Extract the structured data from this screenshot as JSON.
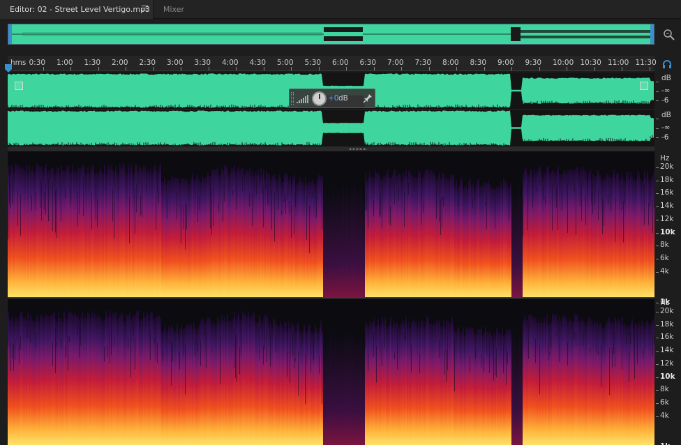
{
  "tabs": {
    "editor_label": "Editor: 02 - Street Level Vertigo.mp3",
    "mixer_label": "Mixer"
  },
  "ruler": {
    "unit": "hms",
    "labels": [
      "0:30",
      "1:00",
      "1:30",
      "2:00",
      "2:30",
      "3:00",
      "3:30",
      "4:00",
      "4:30",
      "5:00",
      "5:30",
      "6:00",
      "6:30",
      "7:00",
      "7:30",
      "8:00",
      "8:30",
      "9:00",
      "9:30",
      "10:00",
      "10:30",
      "11:00",
      "11:30"
    ]
  },
  "hud": {
    "gain_value": "+0",
    "gain_unit": "dB"
  },
  "db_scale": {
    "unit": "dB",
    "inf_label": "-∞",
    "minus6_label": "-6"
  },
  "hz_scale": {
    "unit": "Hz",
    "labels": [
      "20k",
      "18k",
      "16k",
      "14k",
      "12k",
      "10k",
      "8k",
      "6k",
      "4k",
      "1k"
    ]
  },
  "colors": {
    "waveform": "#3ed69e",
    "background": "#1d1d1d",
    "playhead": "#3a8fd0",
    "gain_value": "#5ab0ff"
  },
  "icons": {
    "zoom": "zoom-to-selection-icon",
    "headphones": "headphones-icon",
    "pin": "pin-icon",
    "menu": "hamburger-menu-icon"
  }
}
